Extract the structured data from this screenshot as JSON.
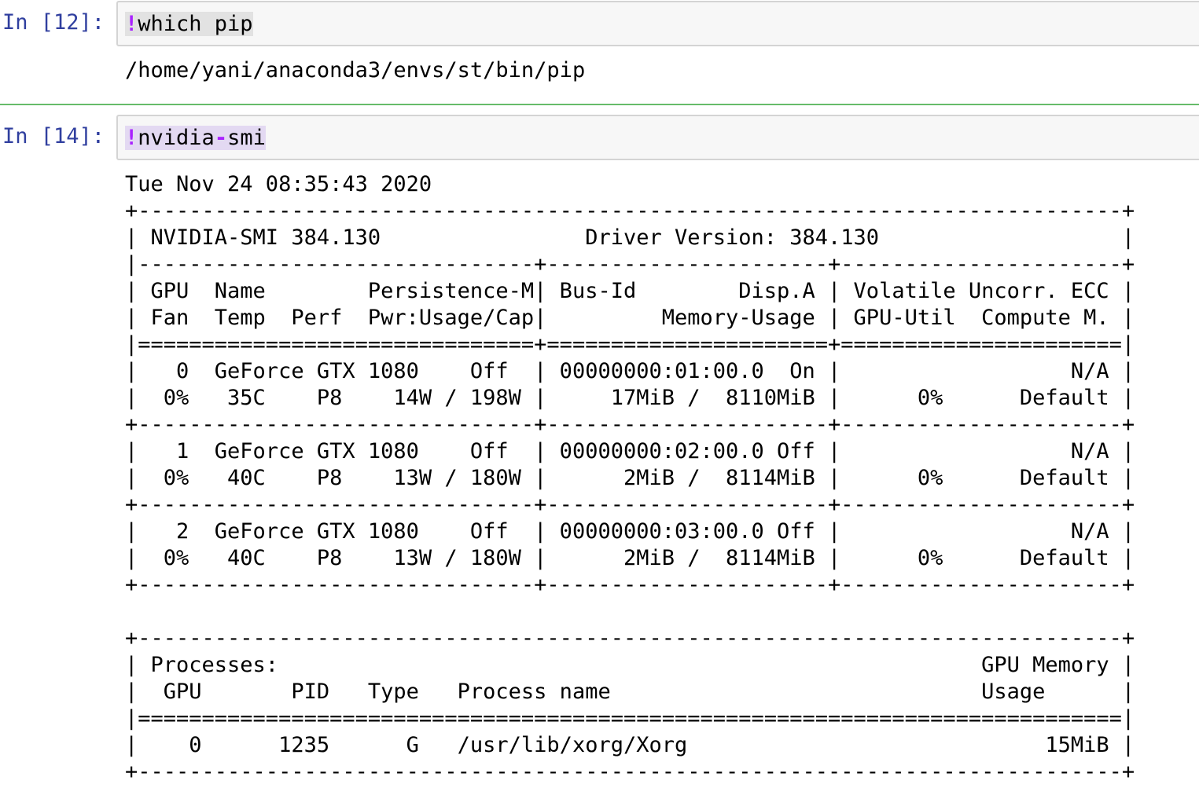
{
  "cells": [
    {
      "prompt": "In [12]:",
      "code_bang": "!",
      "code_text": "which pip",
      "output": "/home/yani/anaconda3/envs/st/bin/pip"
    },
    {
      "prompt": "In [14]:",
      "code_bang": "!",
      "code_part1": "nvidia",
      "code_op": "-",
      "code_part2": "smi",
      "output": "Tue Nov 24 08:35:43 2020       \n+-----------------------------------------------------------------------------+\n| NVIDIA-SMI 384.130                Driver Version: 384.130                   |\n|-------------------------------+----------------------+----------------------+\n| GPU  Name        Persistence-M| Bus-Id        Disp.A | Volatile Uncorr. ECC |\n| Fan  Temp  Perf  Pwr:Usage/Cap|         Memory-Usage | GPU-Util  Compute M. |\n|===============================+======================+======================|\n|   0  GeForce GTX 1080    Off  | 00000000:01:00.0  On |                  N/A |\n|  0%   35C    P8    14W / 198W |     17MiB /  8110MiB |      0%      Default |\n+-------------------------------+----------------------+----------------------+\n|   1  GeForce GTX 1080    Off  | 00000000:02:00.0 Off |                  N/A |\n|  0%   40C    P8    13W / 180W |      2MiB /  8114MiB |      0%      Default |\n+-------------------------------+----------------------+----------------------+\n|   2  GeForce GTX 1080    Off  | 00000000:03:00.0 Off |                  N/A |\n|  0%   40C    P8    13W / 180W |      2MiB /  8114MiB |      0%      Default |\n+-------------------------------+----------------------+----------------------+\n                                                                               \n+-----------------------------------------------------------------------------+\n| Processes:                                                       GPU Memory |\n|  GPU       PID   Type   Process name                             Usage      |\n|=============================================================================|\n|    0      1235      G   /usr/lib/xorg/Xorg                            15MiB |\n+-----------------------------------------------------------------------------+"
    }
  ],
  "colors": {
    "prompt": "#303f9f",
    "bang": "#aa22ff",
    "cell_divider": "#66bb6a",
    "input_background": "#f7f7f7"
  }
}
